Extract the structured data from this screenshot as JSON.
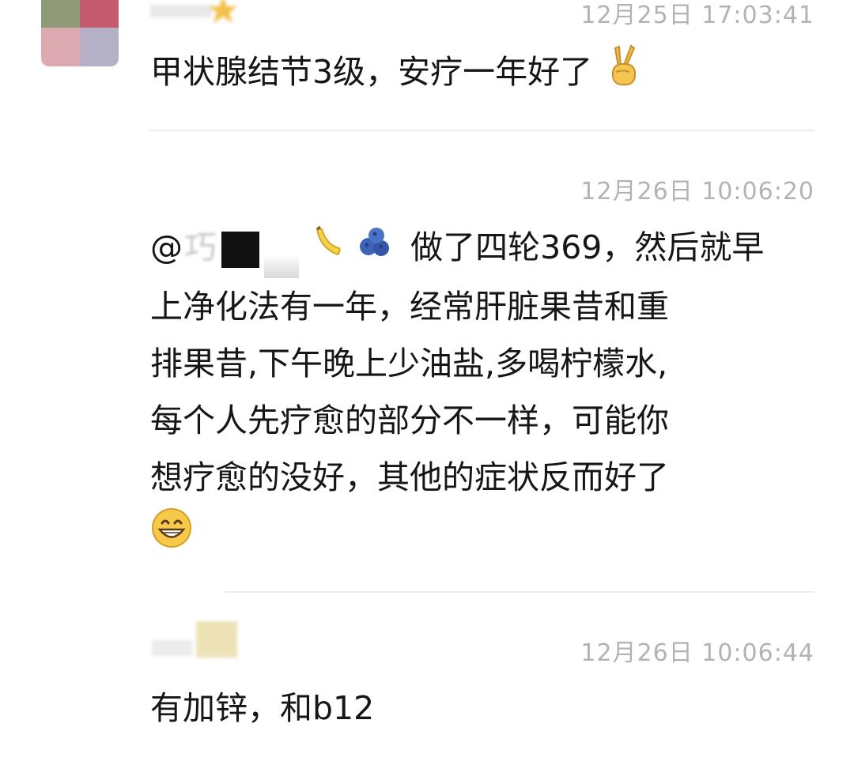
{
  "comments": [
    {
      "timestamp": "12月25日 17:03:41",
      "text": "甲状腺结节3级，安疗一年好了",
      "trailing_emoji": "victory-hand"
    },
    {
      "timestamp": "12月26日 10:06:20",
      "mention_prefix": "@",
      "mention_faint": "巧",
      "mention_emojis": [
        "banana",
        "blueberries"
      ],
      "line1": "做了四轮369，然后就早",
      "line2": "上净化法有一年，经常肝脏果昔和重",
      "line3": "排果昔,下午晚上少油盐,多喝柠檬水,",
      "line4": "每个人先疗愈的部分不一样，可能你",
      "line5": "想疗愈的没好，其他的症状反而好了",
      "trailing_emoji": "grinning-face"
    },
    {
      "timestamp": "12月26日 10:06:44",
      "text": "有加锌，和b12"
    }
  ],
  "colors": {
    "timestamp": "#b3b3b3",
    "text": "#161616",
    "divider": "#ececec"
  }
}
